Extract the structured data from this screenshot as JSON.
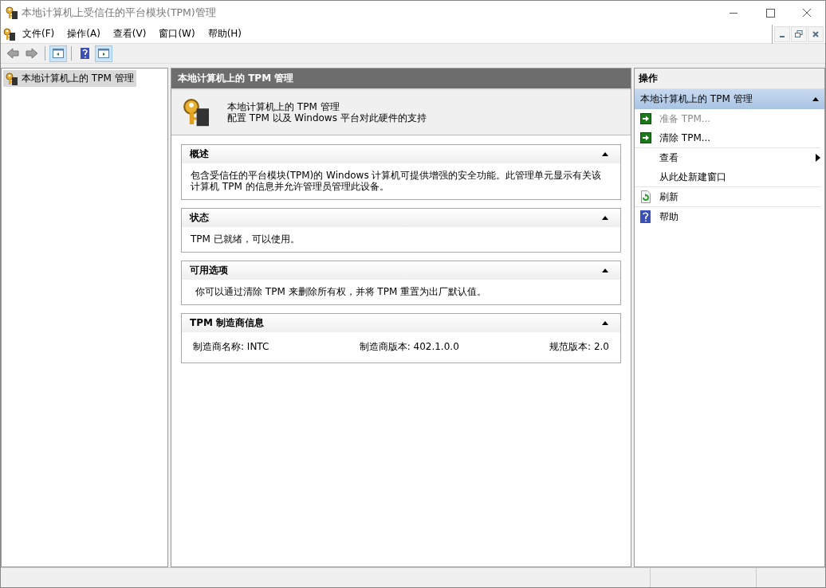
{
  "window": {
    "title": "本地计算机上受信任的平台模块(TPM)管理"
  },
  "menu": [
    "文件(F)",
    "操作(A)",
    "查看(V)",
    "窗口(W)",
    "帮助(H)"
  ],
  "toolbar": [
    {
      "kind": "back",
      "disabled": true
    },
    {
      "kind": "forward",
      "disabled": true
    },
    {
      "kind": "tree-toggle",
      "on": true
    },
    {
      "kind": "help",
      "on": false
    },
    {
      "kind": "action-toggle",
      "on": true
    }
  ],
  "tree": [
    {
      "label": "本地计算机上的 TPM 管理",
      "selected": true
    }
  ],
  "center": {
    "header": "本地计算机上的 TPM 管理",
    "intro": {
      "title": "本地计算机上的 TPM 管理",
      "subtitle": "配置 TPM 以及 Windows 平台对此硬件的支持"
    },
    "sections": [
      {
        "title": "概述",
        "expanded": true,
        "kind": "text",
        "indent": false,
        "text": "包含受信任的平台模块(TPM)的 Windows 计算机可提供增强的安全功能。此管理单元显示有关该计算机 TPM 的信息并允许管理员管理此设备。"
      },
      {
        "title": "状态",
        "expanded": true,
        "kind": "text",
        "indent": false,
        "text": "TPM 已就绪，可以使用。"
      },
      {
        "title": "可用选项",
        "expanded": true,
        "kind": "text",
        "indent": true,
        "text": "你可以通过清除 TPM 来删除所有权，并将 TPM 重置为出厂默认值。"
      },
      {
        "title": "TPM 制造商信息",
        "expanded": true,
        "kind": "fields",
        "fields": [
          "制造商名称: INTC",
          "制造商版本: 402.1.0.0",
          "规范版本: 2.0"
        ]
      }
    ]
  },
  "actions": {
    "header": "操作",
    "group": {
      "title": "本地计算机上的 TPM 管理",
      "expanded": true
    },
    "items": [
      {
        "label": "准备 TPM...",
        "kind": "arrow",
        "disabled": true,
        "submenu": false,
        "divider_after": false
      },
      {
        "label": "清除 TPM...",
        "kind": "arrow",
        "disabled": false,
        "submenu": false,
        "divider_after": true
      },
      {
        "label": "查看",
        "kind": "none",
        "disabled": false,
        "submenu": true,
        "divider_after": false
      },
      {
        "label": "从此处新建窗口",
        "kind": "none",
        "disabled": false,
        "submenu": false,
        "divider_after": true
      },
      {
        "label": "刷新",
        "kind": "refresh",
        "disabled": false,
        "submenu": false,
        "divider_after": true
      },
      {
        "label": "帮助",
        "kind": "help",
        "disabled": false,
        "submenu": false,
        "divider_after": false
      }
    ]
  }
}
